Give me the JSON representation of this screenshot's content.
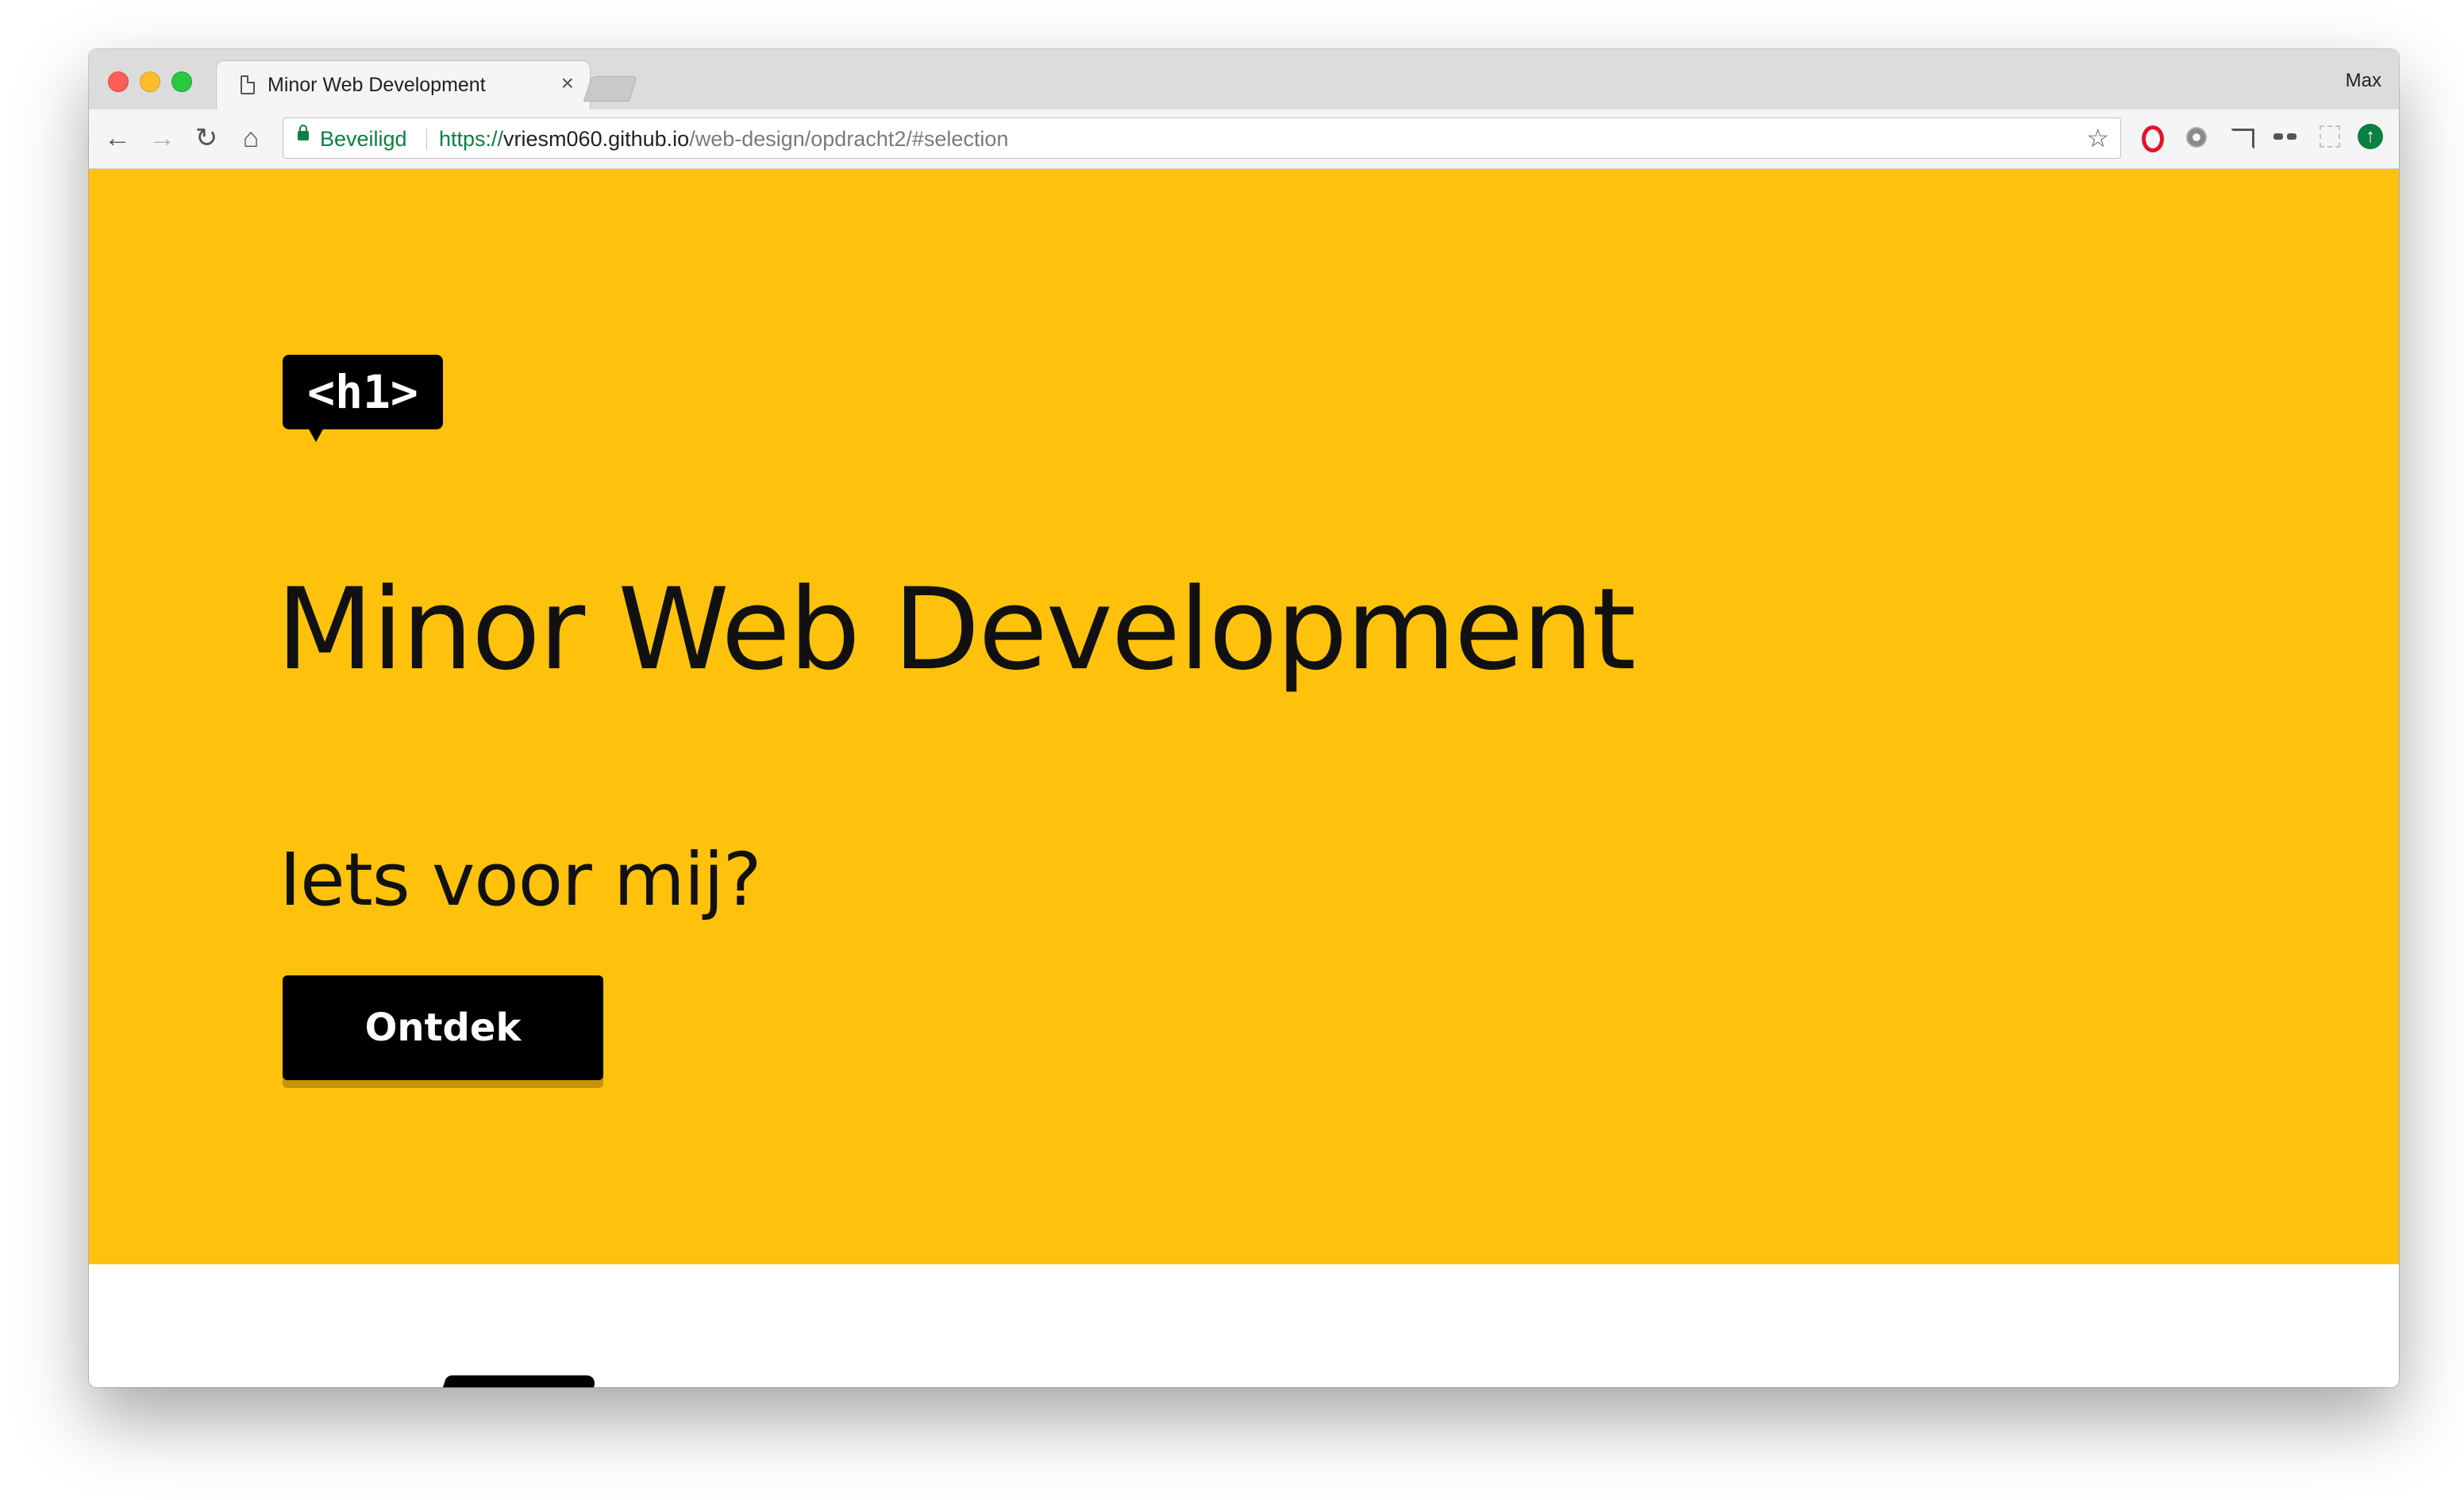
{
  "browser": {
    "tab": {
      "title": "Minor Web Development",
      "close_label": "×"
    },
    "profile_name": "Max",
    "toolbar": {
      "back_label": "←",
      "forward_label": "→",
      "reload_label": "↻",
      "home_label": "⌂",
      "secure_label": "Beveiligd",
      "url_scheme": "https://",
      "url_host": "vriesm060.github.io",
      "url_path": "/web-design/opdracht2/#selection",
      "bookmark_label": "☆"
    },
    "extension_icons": [
      "opera-icon",
      "settings-extension-icon",
      "cast-icon",
      "glasses-extension-icon",
      "blank-extension-icon",
      "update-icon"
    ]
  },
  "page": {
    "badge_text": "<h1>",
    "title": "Minor Web Development",
    "subtitle": "Iets voor mij?",
    "cta_label": "Ontdek",
    "colors": {
      "hero_background": "#fec20c",
      "text": "#111111",
      "button_background": "#000000",
      "button_text": "#ffffff",
      "secure_green": "#0b8043"
    }
  }
}
